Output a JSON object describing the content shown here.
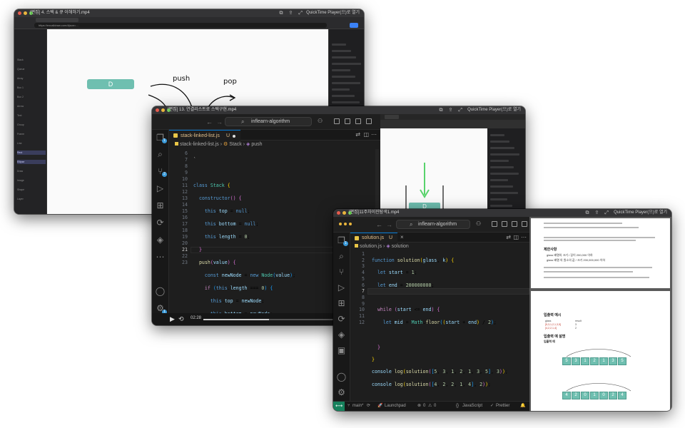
{
  "win1": {
    "title": "[편집] 4. 스택 & 큐 이해하기.mp4",
    "quicktime": "QuickTime Player(으)로 열기",
    "browser_url": "https://excalidraw.com/#json=...",
    "canvas_box_label": "D",
    "push_label": "push",
    "pop_label": "pop",
    "sidebar_items": [
      "Stack",
      "Queue",
      "Array",
      "Box 1",
      "Box 2",
      "Arrow",
      "Text",
      "Group",
      "Frame",
      "Line",
      "Rect",
      "Ellipse",
      "Draw",
      "Image",
      "Shape",
      "Layer"
    ]
  },
  "win2": {
    "title": "[편집] 13. 연결리스트로 스택구현.mp4",
    "quicktime": "QuickTime Player(으)로 열기",
    "search": "inflearn-algorithm",
    "tab_label": "stack-linked-list.js",
    "tab_status": "U",
    "breadcrumb_file": "stack-linked-list.js",
    "breadcrumb_class": "Stack",
    "breadcrumb_method": "push",
    "line_numbers": [
      "6",
      "7",
      "8",
      "9",
      "10",
      "11",
      "12",
      "13",
      "14",
      "15",
      "16",
      "17",
      "18",
      "19",
      "20",
      "21",
      "22",
      "23"
    ],
    "time": "02:28",
    "diagram_label": "D",
    "activity_badges": [
      "1",
      "2",
      "1"
    ]
  },
  "win3": {
    "title": "[편집]11주차이진탐색1.mp4",
    "quicktime": "QuickTime Player(으)로 열기",
    "search": "inflearn-algorithm",
    "tab_label": "solution.js",
    "tab_status": "U",
    "breadcrumb_file": "solution.js",
    "breadcrumb_fn": "solution",
    "line_numbers": [
      "1",
      "2",
      "3",
      "4",
      "5",
      "6",
      "7",
      "8",
      "9",
      "10",
      "11",
      "12"
    ],
    "status_branch": "main*",
    "status_launchpad": "Launchpad",
    "status_errors": "0",
    "status_warnings": "0",
    "status_lang": "JavaScript",
    "status_prettier": "Prettier",
    "doc": {
      "restrict_title": "제한사항",
      "bullets": [
        "glass 배열의 크기 / 길이 200,000 이하",
        "glass 배열 의 원소의 값 / 크기 200,000,000 이하"
      ],
      "io_title": "입출력 예시",
      "col1": "glass",
      "col2": "result",
      "row1a": "[5,3,1,2,1,3,5]",
      "row1b": "3",
      "row2a": "[4,2,2,1,4]",
      "row2b": "2",
      "explain_title": "입출력 예 설명",
      "example_title": "입출력 예",
      "boxes1": [
        "5",
        "3",
        "1",
        "2",
        "1",
        "3",
        "5"
      ],
      "boxes2": [
        "4",
        "2",
        "0",
        "1",
        "0",
        "2",
        "4"
      ]
    },
    "activity_badges": [
      "1"
    ]
  },
  "colors": {
    "teal": "#6fbfb0",
    "accent_blue": "#007acc",
    "editor_bg": "#1e1e1e",
    "green_arrow": "#59d36c"
  }
}
